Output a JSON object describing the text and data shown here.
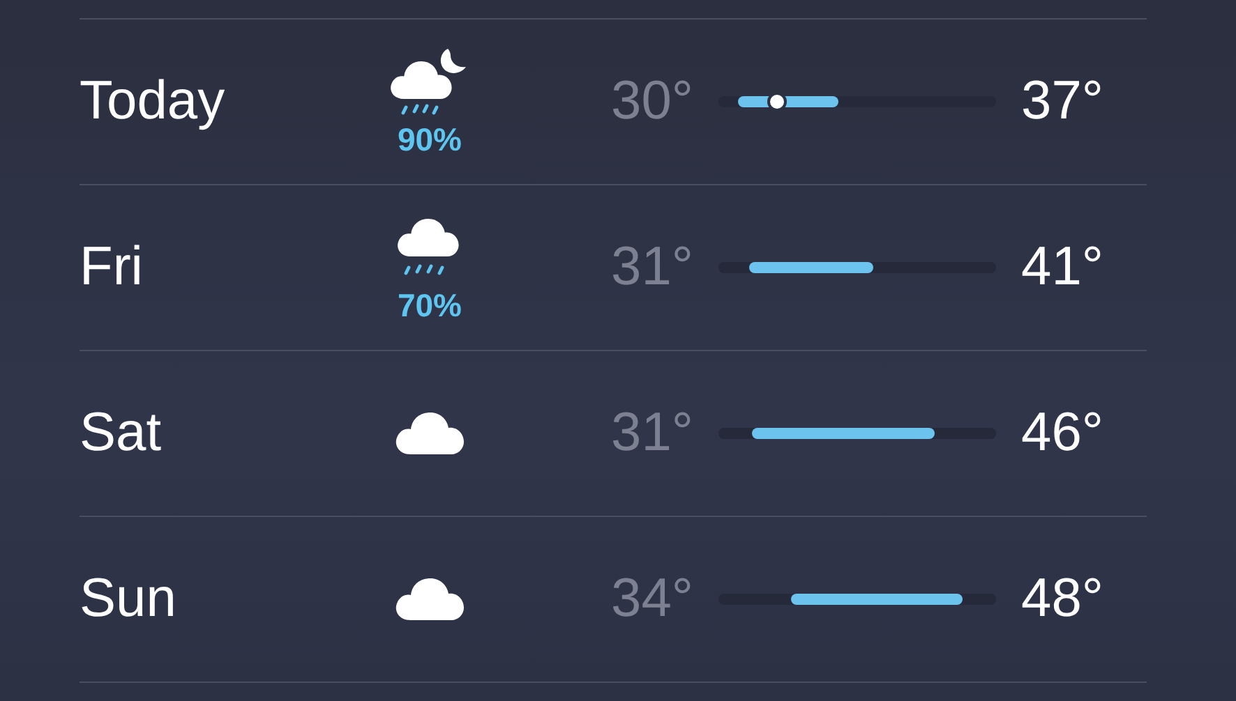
{
  "forecast": [
    {
      "day": "Today",
      "icon": {
        "kind": "cloud-moon-rain"
      },
      "precipitation": "90%",
      "low": "30°",
      "high": "37°",
      "range_bar": {
        "start": {
          "level": 0.09
        },
        "end": {
          "level": 0.41
        },
        "now": {
          "level": 0.21
        }
      }
    },
    {
      "day": "Fri",
      "icon": {
        "kind": "cloud-rain"
      },
      "precipitation": "70%",
      "low": "31°",
      "high": "41°",
      "range_bar": {
        "start": {
          "level": 0.13
        },
        "end": {
          "level": 0.54
        }
      }
    },
    {
      "day": "Sat",
      "icon": {
        "kind": "cloud"
      },
      "low": "31°",
      "high": "46°",
      "range_bar": {
        "start": {
          "level": 0.14
        },
        "end": {
          "level": 0.76
        }
      }
    },
    {
      "day": "Sun",
      "icon": {
        "kind": "cloud"
      },
      "low": "34°",
      "high": "48°",
      "range_bar": {
        "start": {
          "level": 0.28
        },
        "end": {
          "level": 0.86
        }
      }
    }
  ]
}
